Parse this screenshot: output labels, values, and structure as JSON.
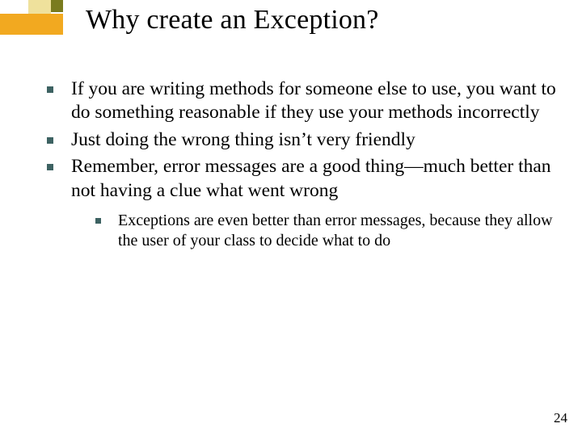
{
  "title": "Why create an Exception?",
  "bullets": [
    {
      "text": "If you are writing methods for someone else to use, you want to do something reasonable if they use your methods incorrectly"
    },
    {
      "text": "Just doing the wrong thing isn’t very friendly"
    },
    {
      "text": "Remember, error messages are a good thing—much better than not having a clue what went wrong",
      "children": [
        {
          "text": "Exceptions are even better than error messages, because they allow the user of your class to decide what to do"
        }
      ]
    }
  ],
  "page_number": "24"
}
